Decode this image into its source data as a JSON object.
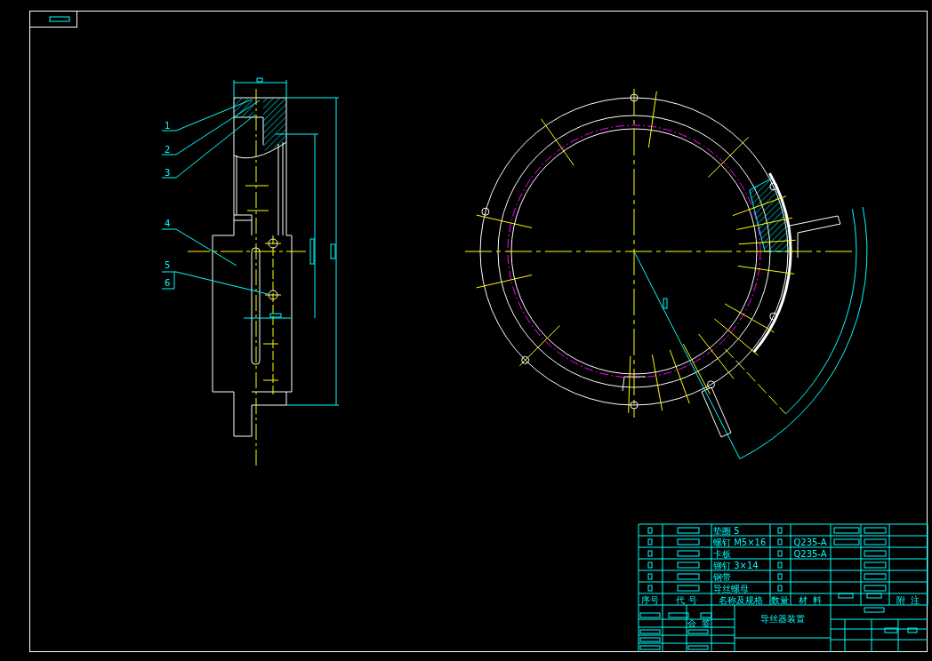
{
  "leaders": [
    {
      "label": "1"
    },
    {
      "label": "2"
    },
    {
      "label": "3"
    },
    {
      "label": "4"
    },
    {
      "label": "5"
    },
    {
      "label": "6"
    }
  ],
  "parts_list": {
    "rows": [
      {
        "name": "垫圈 5"
      },
      {
        "name": "螺钉 M5×16",
        "material": "Q235-A"
      },
      {
        "name": "卡板",
        "material": "Q235-A"
      },
      {
        "name": "铆钉 3×14"
      },
      {
        "name": "钢带"
      },
      {
        "name": "导丝螺母"
      }
    ],
    "header": [
      "序号",
      "代 号",
      "名称及规格",
      "数量",
      "材  料",
      "附  注"
    ]
  },
  "title_block": {
    "drawing_title": "导丝器装置",
    "sign_label": "会  签"
  }
}
